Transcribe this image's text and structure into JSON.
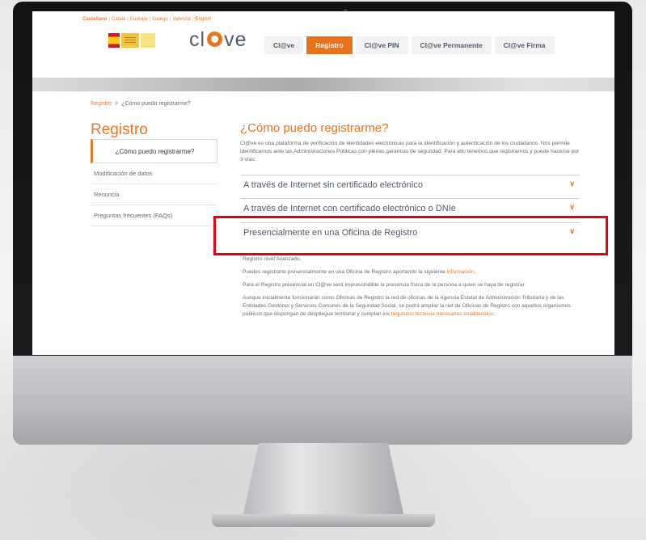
{
  "top_bar": {
    "languages": [
      "Castellano",
      "Català",
      "Euskara",
      "Galego",
      "Valencià",
      "English"
    ]
  },
  "logo": {
    "brand": "cl@ve",
    "brand_prefix": "cl",
    "brand_suffix": "ve"
  },
  "nav": {
    "items": [
      {
        "label": "Cl@ve",
        "active": false
      },
      {
        "label": "Registro",
        "active": true
      },
      {
        "label": "Cl@ve PIN",
        "active": false
      },
      {
        "label": "Cl@ve Permanente",
        "active": false
      },
      {
        "label": "Cl@ve Firma",
        "active": false
      }
    ]
  },
  "breadcrumb": {
    "root": "Registro",
    "separator": ">",
    "current": "¿Cómo puedo registrarme?"
  },
  "sidebar": {
    "title": "Registro",
    "items": [
      {
        "label": "¿Cómo puedo registrarme?"
      },
      {
        "label": "Modificación de datos"
      },
      {
        "label": "Renuncia"
      },
      {
        "label": "Preguntas frecuentes (FAQs)"
      }
    ]
  },
  "main": {
    "title": "¿Cómo puedo registrarme?",
    "intro": "Cl@ve es una plataforma de verificación de identidades electrónicas para la identificación y autenticación de los ciudadanos. Nos permite identificarnos ante las Administraciones Públicas con plenas garantías de seguridad. Para ello tenemos que registrarnos y puede hacerse por 3 vías:",
    "accordion": [
      {
        "label": "A través de Internet sin certificado electrónico"
      },
      {
        "label": "A través de Internet con certificado electrónico o DNIe"
      },
      {
        "label": "Presencialmente en una Oficina de Registro"
      }
    ],
    "details": {
      "p1": "Registro nivel Avanzado.",
      "p2_pre": "Puedes registrarte presencialmente en una Oficina de Registro aportando la siguiente ",
      "p2_link": "información",
      "p2_post": ".",
      "p3": "Para el Registro presencial en Cl@ve será imprescindible la presencia física de la persona a quien se haya de registrar.",
      "p4_pre": "Aunque inicialmente funcionarán como Oficinas de Registro la red de oficinas de la Agencia Estatal de Administración Tributaria y de las Entidades Gestoras y Servicios Comunes de la Seguridad Social, se podrá ampliar la red de Oficinas de Registro con aquellos organismos públicos que dispongan de despliegue territorial y cumplan los ",
      "p4_link": "requisitos técnicos necesarios establecidos",
      "p4_post": "."
    }
  },
  "colors": {
    "accent": "#e8731c",
    "highlight_box": "#e8000d",
    "text": "#505a6b"
  },
  "icons": {
    "accordion_chevron": "chevron-down-icon",
    "clave_at": "at-circle-icon"
  }
}
